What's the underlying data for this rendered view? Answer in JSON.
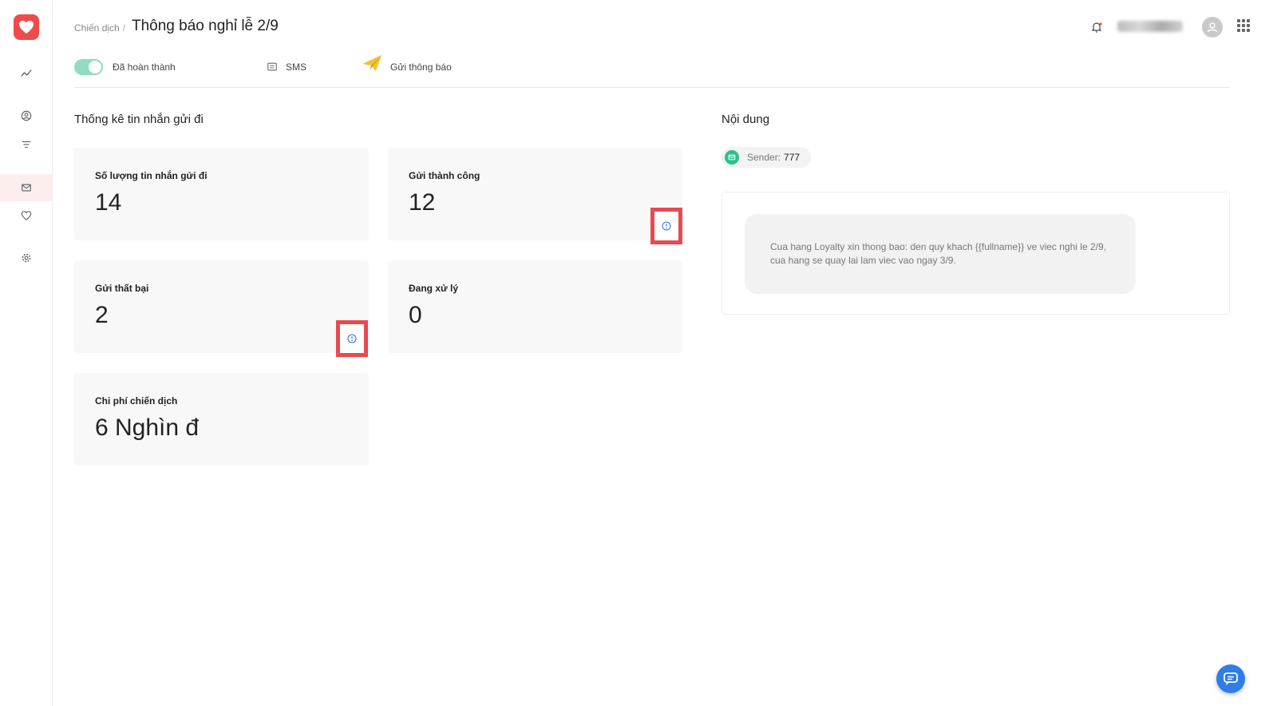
{
  "breadcrumb": {
    "parent": "Chiến dịch",
    "separator": "/"
  },
  "page_title": "Thông báo nghỉ lễ 2/9",
  "meta": {
    "status_label": "Đã hoàn thành",
    "channel_label": "SMS",
    "type_label": "Gửi thông báo"
  },
  "stats": {
    "title": "Thống kê tin nhắn gửi đi",
    "cards": [
      {
        "label": "Số lượng tin nhắn gửi đi",
        "value": "14"
      },
      {
        "label": "Gửi thành công",
        "value": "12"
      },
      {
        "label": "Gửi thất bại",
        "value": "2"
      },
      {
        "label": "Đang xử lý",
        "value": "0"
      },
      {
        "label": "Chi phí chiến dịch",
        "value": "6 Nghìn đ"
      }
    ]
  },
  "content": {
    "title": "Nội dung",
    "sender_label": "Sender:",
    "sender_value": "777",
    "message": "Cua hang Loyalty xin thong bao: den quy khach {{fullname}} ve viec nghi le 2/9, cua hang se quay lai lam viec vao ngay 3/9."
  },
  "colors": {
    "brand": "#ef4b4b",
    "toggle_on": "#8fdcc0",
    "highlight_border": "#e84a4f",
    "sender_icon": "#27c28b",
    "chat_button": "#2f7ee8",
    "info_icon": "#2f6fd6"
  },
  "icons": {
    "logo": "heart-icon",
    "nav": [
      "chart-line-icon",
      "user-circle-icon",
      "filter-icon",
      "mail-icon",
      "heart-outline-icon",
      "gear-icon"
    ]
  }
}
